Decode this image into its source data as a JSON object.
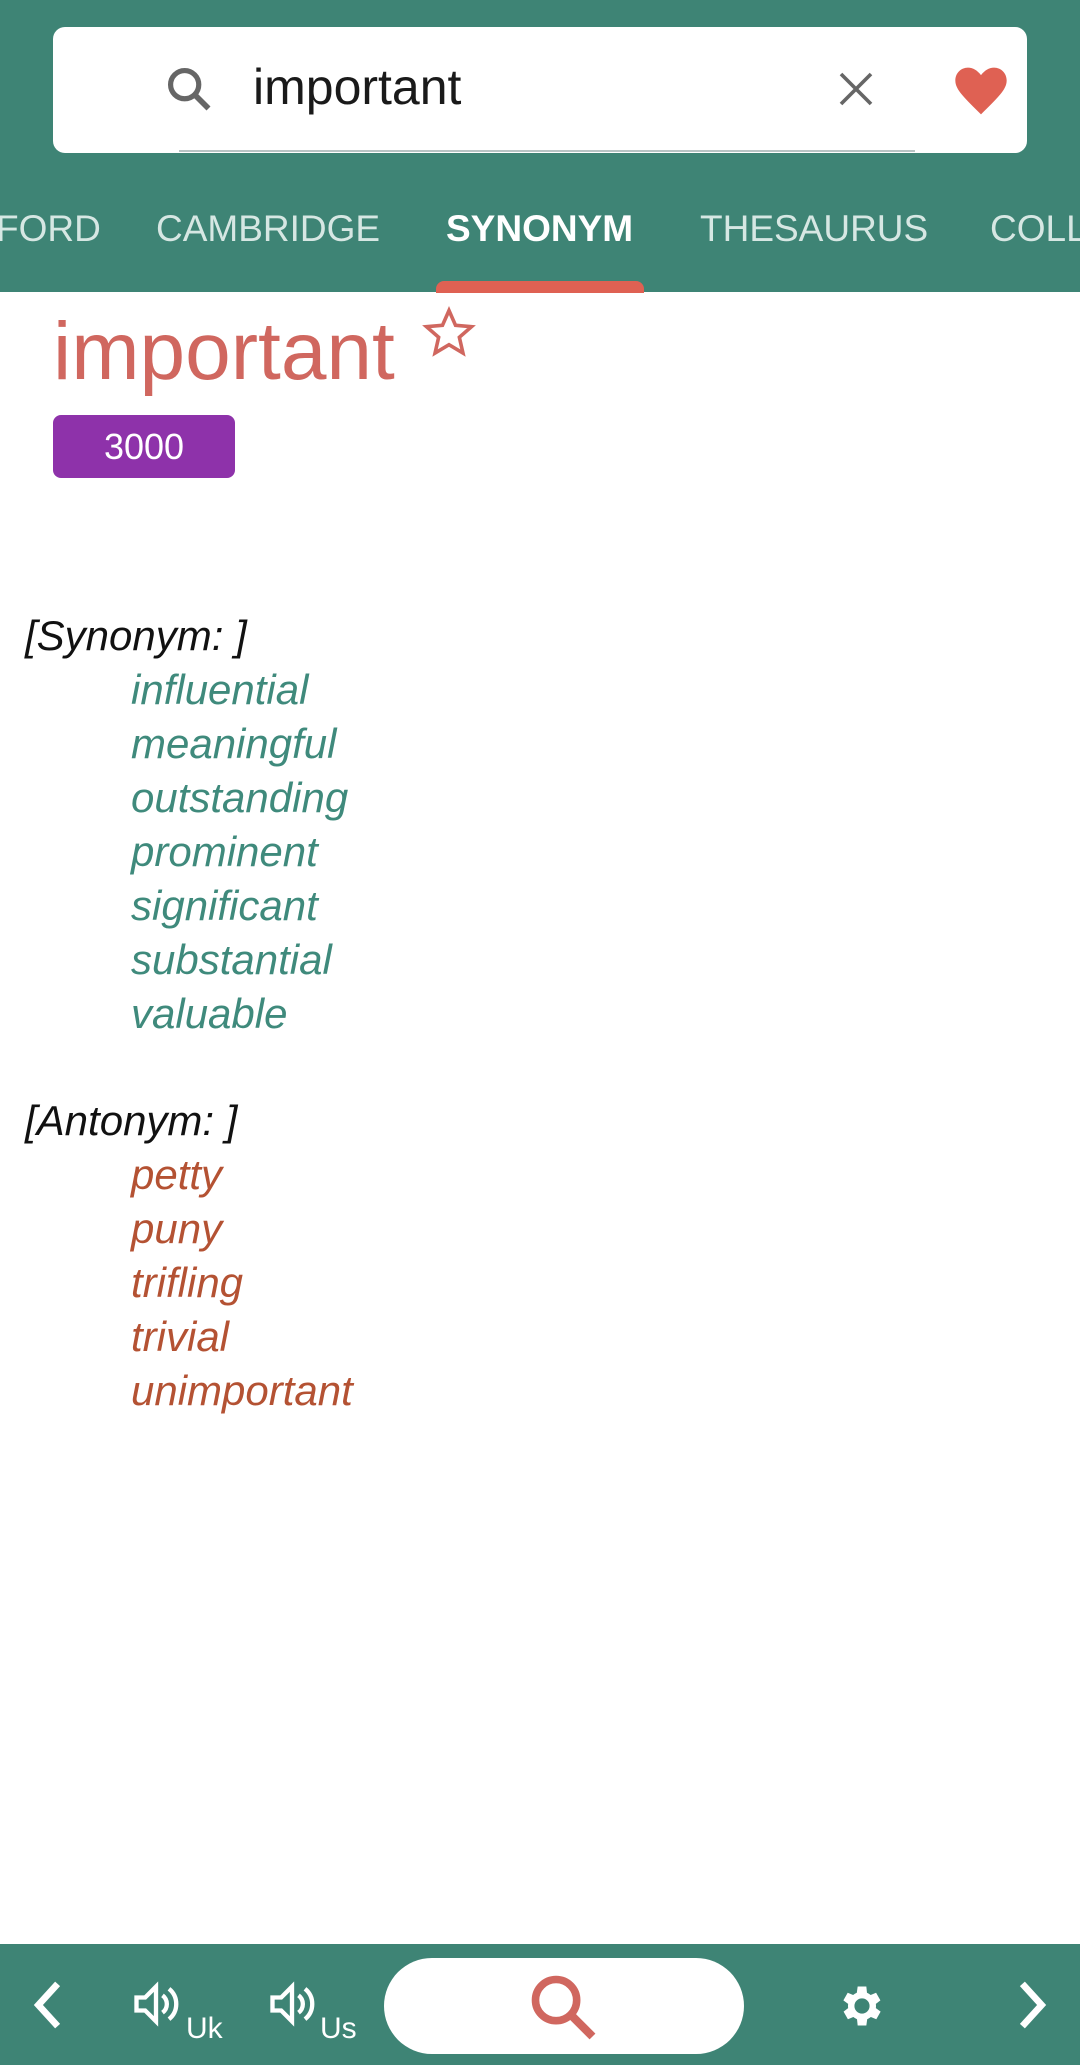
{
  "search": {
    "query": "important",
    "icons": [
      "search-icon",
      "close-icon",
      "heart-icon"
    ],
    "heart_color": "#df6153"
  },
  "tabs": [
    {
      "label": "FORD"
    },
    {
      "label": "CAMBRIDGE"
    },
    {
      "label": "SYNONYM",
      "active": true
    },
    {
      "label": "THESAURUS"
    },
    {
      "label": "COLL"
    }
  ],
  "entry": {
    "word": "important",
    "badge": "3000",
    "word_color": "#d0675f",
    "badge_color": "#8e32aa"
  },
  "synonyms": {
    "label": "[Synonym: ]",
    "items": [
      "influential",
      "meaningful",
      "outstanding",
      "prominent",
      "significant",
      "substantial",
      "valuable"
    ]
  },
  "antonyms": {
    "label": "[Antonym: ]",
    "items": [
      "petty",
      "puny",
      "trifling",
      "trivial",
      "unimportant"
    ]
  },
  "bottom_bar": {
    "uk_label": "Uk",
    "us_label": "Us",
    "icons": [
      "chevron-left-icon",
      "speaker-icon",
      "speaker-icon",
      "search-icon",
      "gear-icon",
      "chevron-right-icon"
    ]
  },
  "colors": {
    "primary": "#3e8475",
    "accent": "#df6153"
  }
}
